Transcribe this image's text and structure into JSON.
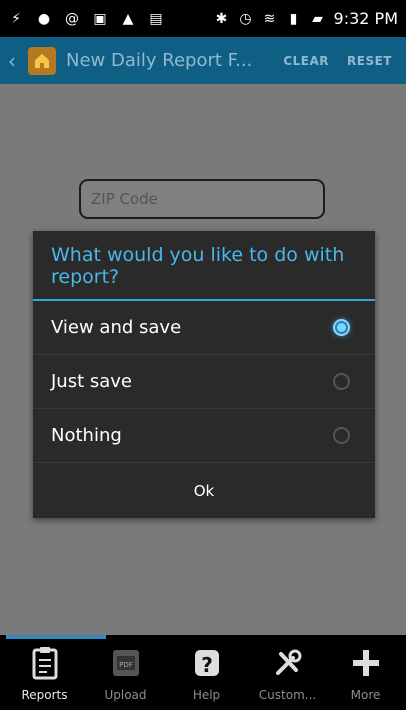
{
  "status_bar": {
    "time": "9:32 PM",
    "icons": [
      "usb-icon",
      "chat-icon",
      "at-icon",
      "image-icon",
      "warning-icon",
      "photo-icon",
      "bluetooth-icon",
      "alarm-icon",
      "wifi-icon",
      "signal-icon",
      "battery-icon"
    ]
  },
  "app_bar": {
    "title": "New Daily Report F...",
    "clear": "CLEAR",
    "reset": "RESET"
  },
  "form": {
    "zip_placeholder": "ZIP Code"
  },
  "dialog": {
    "title": "What would you like to do with report?",
    "options": [
      {
        "label": "View and save",
        "selected": true
      },
      {
        "label": "Just save",
        "selected": false
      },
      {
        "label": "Nothing",
        "selected": false
      }
    ],
    "ok": "Ok"
  },
  "tabbar": {
    "tabs": [
      {
        "label": "Reports",
        "icon": "clipboard-icon",
        "active": true
      },
      {
        "label": "Upload",
        "icon": "pdf-icon",
        "active": false
      },
      {
        "label": "Help",
        "icon": "help-icon",
        "active": false
      },
      {
        "label": "Custom...",
        "icon": "tools-icon",
        "active": false
      },
      {
        "label": "More",
        "icon": "plus-icon",
        "active": false
      }
    ]
  }
}
